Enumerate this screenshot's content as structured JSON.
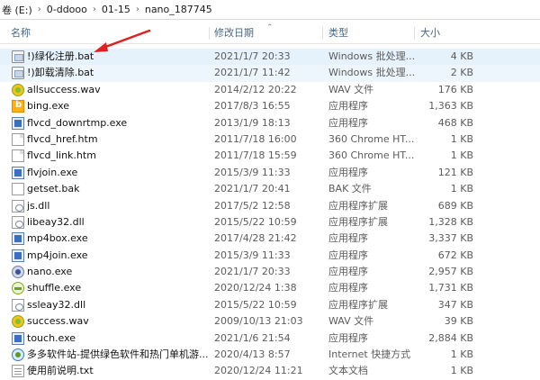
{
  "address": {
    "drive": "卷 (E:)",
    "segments": [
      "0-ddooo",
      "01-15",
      "nano_187745"
    ],
    "sep": "›"
  },
  "columns": {
    "name": "名称",
    "date": "修改日期",
    "type": "类型",
    "size": "大小"
  },
  "files": [
    {
      "name": "!)绿化注册.bat",
      "date": "2021/1/7 20:33",
      "type": "Windows 批处理...",
      "size": "4 KB",
      "icon": "batch-file-icon"
    },
    {
      "name": "!)卸载清除.bat",
      "date": "2021/1/7 11:42",
      "type": "Windows 批处理...",
      "size": "2 KB",
      "icon": "batch-file-icon"
    },
    {
      "name": "allsuccess.wav",
      "date": "2014/2/12 20:22",
      "type": "WAV 文件",
      "size": "176 KB",
      "icon": "audio-file-icon"
    },
    {
      "name": "bing.exe",
      "date": "2017/8/3 16:55",
      "type": "应用程序",
      "size": "1,363 KB",
      "icon": "bing-app-icon"
    },
    {
      "name": "flvcd_downrtmp.exe",
      "date": "2013/1/9 18:13",
      "type": "应用程序",
      "size": "468 KB",
      "icon": "application-icon"
    },
    {
      "name": "flvcd_href.htm",
      "date": "2011/7/18 16:00",
      "type": "360 Chrome HT...",
      "size": "1 KB",
      "icon": "html-file-icon"
    },
    {
      "name": "flvcd_link.htm",
      "date": "2011/7/18 15:59",
      "type": "360 Chrome HT...",
      "size": "1 KB",
      "icon": "html-file-icon"
    },
    {
      "name": "flvjoin.exe",
      "date": "2015/3/9 11:33",
      "type": "应用程序",
      "size": "121 KB",
      "icon": "application-icon"
    },
    {
      "name": "getset.bak",
      "date": "2021/1/7 20:41",
      "type": "BAK 文件",
      "size": "1 KB",
      "icon": "blank-file-icon"
    },
    {
      "name": "js.dll",
      "date": "2017/5/2 12:58",
      "type": "应用程序扩展",
      "size": "689 KB",
      "icon": "dll-file-icon"
    },
    {
      "name": "libeay32.dll",
      "date": "2015/5/22 10:59",
      "type": "应用程序扩展",
      "size": "1,328 KB",
      "icon": "dll-file-icon"
    },
    {
      "name": "mp4box.exe",
      "date": "2017/4/28 21:42",
      "type": "应用程序",
      "size": "3,337 KB",
      "icon": "application-icon"
    },
    {
      "name": "mp4join.exe",
      "date": "2015/3/9 11:33",
      "type": "应用程序",
      "size": "672 KB",
      "icon": "application-icon"
    },
    {
      "name": "nano.exe",
      "date": "2021/1/7 20:33",
      "type": "应用程序",
      "size": "2,957 KB",
      "icon": "nano-app-icon"
    },
    {
      "name": "shuffle.exe",
      "date": "2020/12/24 1:38",
      "type": "应用程序",
      "size": "1,731 KB",
      "icon": "shuffle-app-icon"
    },
    {
      "name": "ssleay32.dll",
      "date": "2015/5/22 10:59",
      "type": "应用程序扩展",
      "size": "347 KB",
      "icon": "dll-file-icon"
    },
    {
      "name": "success.wav",
      "date": "2009/10/13 21:03",
      "type": "WAV 文件",
      "size": "39 KB",
      "icon": "audio-file-icon"
    },
    {
      "name": "touch.exe",
      "date": "2021/1/6 21:54",
      "type": "应用程序",
      "size": "2,884 KB",
      "icon": "application-icon"
    },
    {
      "name": "多多软件站-提供绿色软件和热门单机游...",
      "date": "2020/4/13 8:57",
      "type": "Internet 快捷方式",
      "size": "1 KB",
      "icon": "internet-shortcut-icon"
    },
    {
      "name": "使用前说明.txt",
      "date": "2020/12/24 11:21",
      "type": "文本文档",
      "size": "1 KB",
      "icon": "text-file-icon"
    }
  ],
  "colors": {
    "header_text": "#4a6784",
    "selected_row": "#e5f1fb",
    "arrow": "#e02020"
  }
}
